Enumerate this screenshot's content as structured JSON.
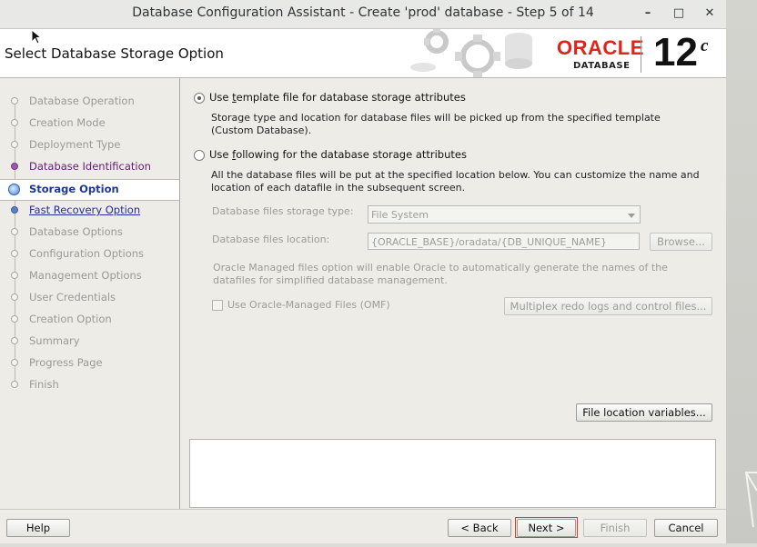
{
  "window": {
    "title": "Database Configuration Assistant - Create 'prod' database - Step 5 of 14",
    "minimize": "–",
    "maximize": "□",
    "close": "✕"
  },
  "header": {
    "page_title": "Select Database Storage Option",
    "brand": "ORACLE",
    "product": "DATABASE",
    "version": "12",
    "version_suffix": "c"
  },
  "nav": {
    "items": [
      {
        "label": "Database Operation",
        "state": "dim"
      },
      {
        "label": "Creation Mode",
        "state": "dim"
      },
      {
        "label": "Deployment Type",
        "state": "dim"
      },
      {
        "label": "Database Identification",
        "state": "visited"
      },
      {
        "label": "Storage Option",
        "state": "current"
      },
      {
        "label": "Fast Recovery Option",
        "state": "link"
      },
      {
        "label": "Database Options",
        "state": "dim"
      },
      {
        "label": "Configuration Options",
        "state": "dim"
      },
      {
        "label": "Management Options",
        "state": "dim"
      },
      {
        "label": "User Credentials",
        "state": "dim"
      },
      {
        "label": "Creation Option",
        "state": "dim"
      },
      {
        "label": "Summary",
        "state": "dim"
      },
      {
        "label": "Progress Page",
        "state": "dim"
      },
      {
        "label": "Finish",
        "state": "dim"
      }
    ]
  },
  "main": {
    "option_template": {
      "label_pre": "Use ",
      "label_mnemonic": "t",
      "label_post": "emplate file for database storage attributes",
      "selected": true,
      "description": "Storage type and location for database files will be picked up from the specified template (Custom Database)."
    },
    "option_following": {
      "label_pre": "Use ",
      "label_mnemonic": "f",
      "label_post": "ollowing for the database storage attributes",
      "selected": false,
      "description": "All the database files will be put at the specified location below. You can customize the name and location of each datafile in the subsequent screen."
    },
    "storage_type_label": "Database files storage type:",
    "storage_type_value": "File System",
    "location_label": "Database files location:",
    "location_value": "{ORACLE_BASE}/oradata/{DB_UNIQUE_NAME}",
    "browse_label": "Browse...",
    "omf_note": "Oracle Managed files option will enable Oracle to automatically generate the names of the datafiles for simplified database management.",
    "omf_checkbox_label": "Use Oracle-Managed Files (OMF)",
    "multiplex_label": "Multiplex redo logs and control files...",
    "file_location_vars_label": "File location variables..."
  },
  "footer": {
    "help": "Help",
    "back": "< Back",
    "next": "Next >",
    "finish": "Finish",
    "cancel": "Cancel"
  },
  "colors": {
    "oracle_red": "#e2231a",
    "highlight_border": "#d63a2f"
  }
}
